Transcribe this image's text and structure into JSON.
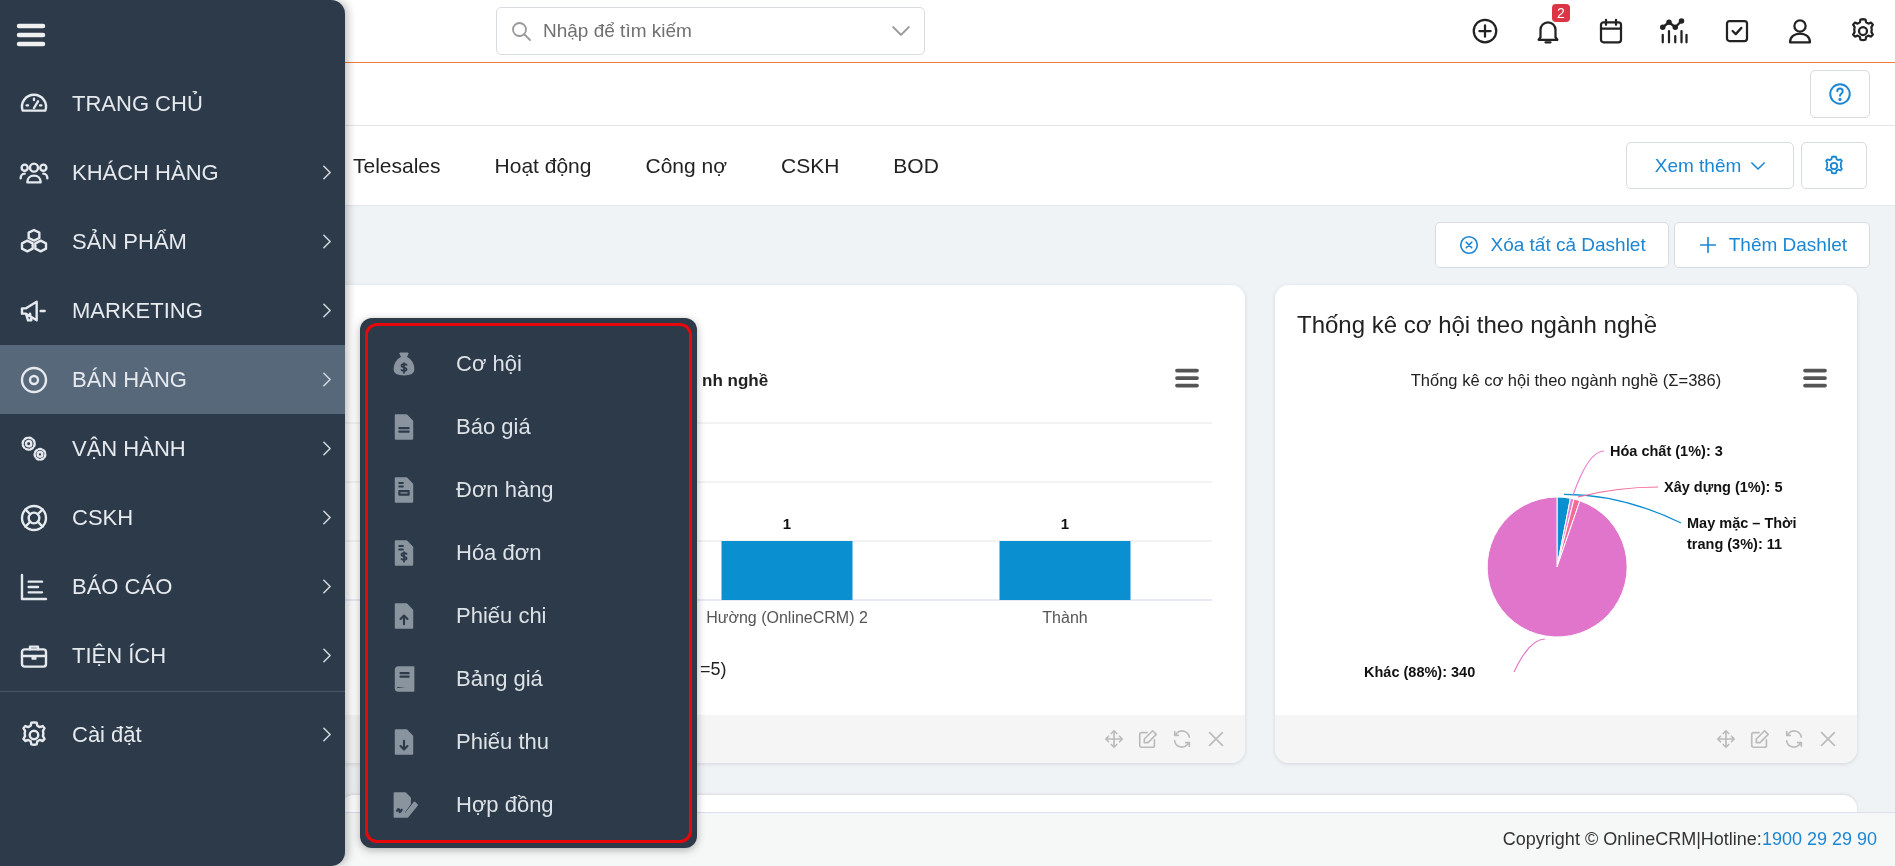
{
  "header": {
    "search": {
      "placeholder": "Nhập để tìm kiếm"
    },
    "notification_count": "2"
  },
  "dashboard_tabs": [
    {
      "label": "Telesales"
    },
    {
      "label": "Hoạt động"
    },
    {
      "label": "Công nợ"
    },
    {
      "label": "CSKH"
    },
    {
      "label": "BOD"
    }
  ],
  "more_button": "Xem thêm",
  "actions": [
    "Xóa tất cả Dashlet",
    "Thêm Dashlet"
  ],
  "dashlets": [
    {
      "legend_fragment": "=5)",
      "chart_data": {
        "type": "bar",
        "title": "nh nghề",
        "categories": [
          "Hường (OnlineCRM) 2",
          "Thành"
        ],
        "values": [
          1,
          1
        ],
        "data_labels": true
      }
    },
    {
      "title": "Thống kê cơ hội theo ngành nghề",
      "chart_data": {
        "type": "pie",
        "title": "Thống kê cơ hội theo ngành nghề (Σ=386)",
        "values": [
          11,
          3,
          5,
          340
        ],
        "value_labels": [
          "May mặc – Thời trang (3%): 11",
          "Hóa chất (1%): 3",
          "Xây dựng (1%): 5",
          "Khác (88%): 340"
        ]
      }
    }
  ],
  "footer": {
    "copyright": "Copyright © OnlineCRM|Hotline: ",
    "hotline": "1900 29 29 90"
  },
  "sidebar": {
    "items": [
      {
        "label": "TRANG CHỦ",
        "selected": false,
        "submenu": false
      },
      {
        "label": "KHÁCH HÀNG",
        "selected": false,
        "submenu": true
      },
      {
        "label": "SẢN PHẨM",
        "selected": false,
        "submenu": true
      },
      {
        "label": "MARKETING",
        "selected": false,
        "submenu": true
      },
      {
        "label": "BÁN HÀNG",
        "selected": true,
        "submenu": true
      },
      {
        "label": "VẬN HÀNH",
        "selected": false,
        "submenu": true
      },
      {
        "label": "CSKH",
        "selected": false,
        "submenu": true
      },
      {
        "label": "BÁO CÁO",
        "selected": false,
        "submenu": true
      },
      {
        "label": "TIỆN ÍCH",
        "selected": false,
        "submenu": true
      }
    ],
    "bottom_items": [
      {
        "label": "Cài đặt",
        "selected": false,
        "submenu": true
      }
    ]
  },
  "submenu": {
    "items": [
      {
        "label": "Cơ hội"
      },
      {
        "label": "Báo giá"
      },
      {
        "label": "Đơn hàng"
      },
      {
        "label": "Hóa đơn"
      },
      {
        "label": "Phiếu chi"
      },
      {
        "label": "Bảng giá"
      },
      {
        "label": "Phiếu thu"
      },
      {
        "label": "Hợp đồng"
      }
    ]
  }
}
